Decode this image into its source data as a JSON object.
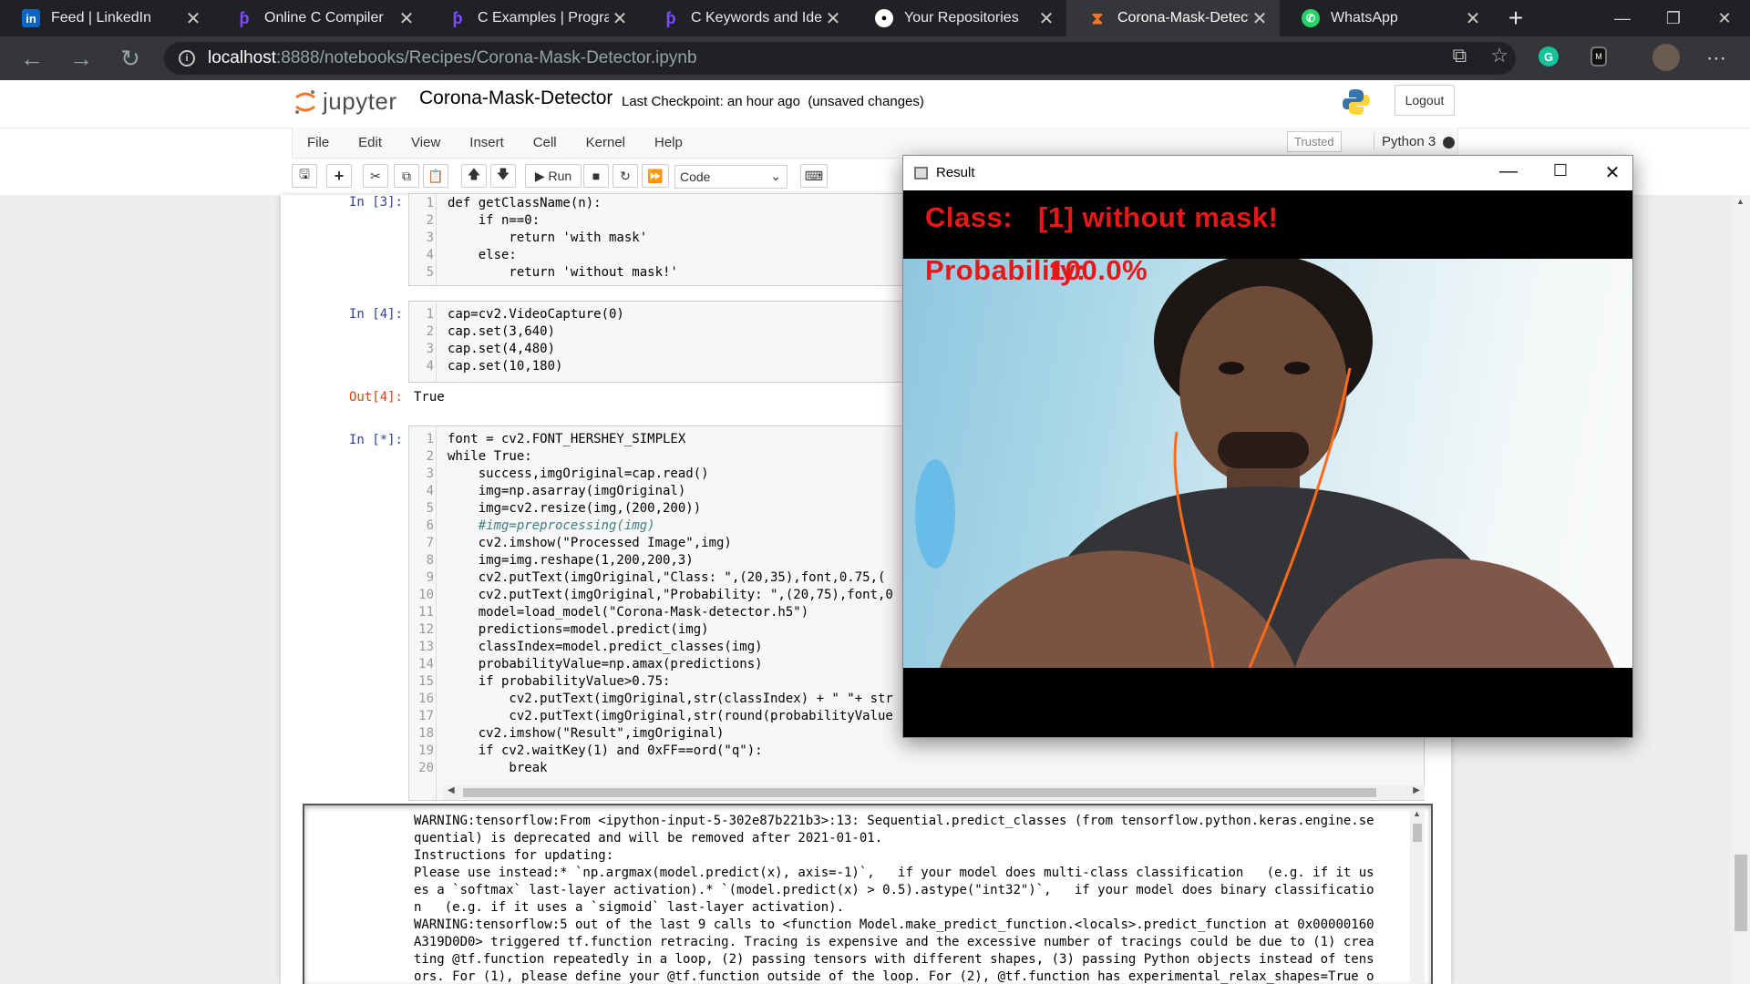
{
  "browser": {
    "tabs": [
      {
        "label": "Feed | LinkedIn",
        "icon": "linkedin-icon"
      },
      {
        "label": "Online C Compiler",
        "icon": "programiz-icon"
      },
      {
        "label": "C Examples | Programiz",
        "icon": "programiz-icon"
      },
      {
        "label": "C Keywords and Identifiers",
        "icon": "programiz-icon"
      },
      {
        "label": "Your Repositories",
        "icon": "github-icon"
      },
      {
        "label": "Corona-Mask-Detector",
        "icon": "jupyter-icon"
      },
      {
        "label": "WhatsApp",
        "icon": "whatsapp-icon"
      }
    ],
    "url_host": "localhost",
    "url_path": ":8888/notebooks/Recipes/Corona-Mask-Detector.ipynb"
  },
  "jupyter": {
    "logo_text": "jupyter",
    "notebook_name": "Corona-Mask-Detector",
    "checkpoint": "Last Checkpoint: an hour ago",
    "status": "(unsaved changes)",
    "logout": "Logout",
    "menus": [
      "File",
      "Edit",
      "View",
      "Insert",
      "Cell",
      "Kernel",
      "Help"
    ],
    "trusted": "Trusted",
    "kernel": "Python 3",
    "run_label": "Run",
    "cell_type": "Code"
  },
  "cells": {
    "c3": {
      "prompt": "In [3]:",
      "lines": [
        "def getClassName(n):",
        "    if n==0:",
        "        return 'with mask'",
        "    else:",
        "        return 'without mask!'"
      ]
    },
    "c4": {
      "prompt": "In [4]:",
      "lines": [
        "cap=cv2.VideoCapture(0)",
        "cap.set(3,640)",
        "cap.set(4,480)",
        "cap.set(10,180)"
      ],
      "out_prompt": "Out[4]:",
      "out": "True"
    },
    "c5": {
      "prompt": "In [*]:",
      "lines": [
        "font = cv2.FONT_HERSHEY_SIMPLEX",
        "while True:",
        "    success,imgOriginal=cap.read()",
        "    img=np.asarray(imgOriginal)",
        "    img=cv2.resize(img,(200,200))",
        "    #img=preprocessing(img)",
        "    cv2.imshow(\"Processed Image\",img)",
        "    img=img.reshape(1,200,200,3)",
        "    cv2.putText(imgOriginal,\"Class: \",(20,35),font,0.75,(",
        "    cv2.putText(imgOriginal,\"Probability: \",(20,75),font,0",
        "    model=load_model(\"Corona-Mask-detector.h5\")",
        "    predictions=model.predict(img)",
        "    classIndex=model.predict_classes(img)",
        "    probabilityValue=np.amax(predictions)",
        "    if probabilityValue>0.75:",
        "        cv2.putText(imgOriginal,str(classIndex) + \" \"+ str",
        "        cv2.putText(imgOriginal,str(round(probabilityValue",
        "    cv2.imshow(\"Result\",imgOriginal)",
        "    if cv2.waitKey(1) and 0xFF==ord(\"q\"):",
        "        break"
      ]
    }
  },
  "stderr_lines": [
    "WARNING:tensorflow:From <ipython-input-5-302e87b221b3>:13: Sequential.predict_classes (from tensorflow.python.keras.engine.se",
    "quential) is deprecated and will be removed after 2021-01-01.",
    "Instructions for updating:",
    "Please use instead:* `np.argmax(model.predict(x), axis=-1)`,   if your model does multi-class classification   (e.g. if it us",
    "es a `softmax` last-layer activation).* `(model.predict(x) > 0.5).astype(\"int32\")`,   if your model does binary classificatio",
    "n   (e.g. if it uses a `sigmoid` last-layer activation).",
    "WARNING:tensorflow:5 out of the last 9 calls to <function Model.make_predict_function.<locals>.predict_function at 0x00000160",
    "A319D0D0> triggered tf.function retracing. Tracing is expensive and the excessive number of tracings could be due to (1) crea",
    "ting @tf.function repeatedly in a loop, (2) passing tensors with different shapes, (3) passing Python objects instead of tens",
    "ors. For (1), please define your @tf.function outside of the loop. For (2), @tf.function has experimental_relax_shapes=True o"
  ],
  "result_window": {
    "title": "Result",
    "class_label": "Class:",
    "class_value": "[1] without mask!",
    "prob_label": "Probability:",
    "prob_value": "100.0%"
  },
  "colors": {
    "overlay_text": "#e81818",
    "accent": "#f37626"
  }
}
